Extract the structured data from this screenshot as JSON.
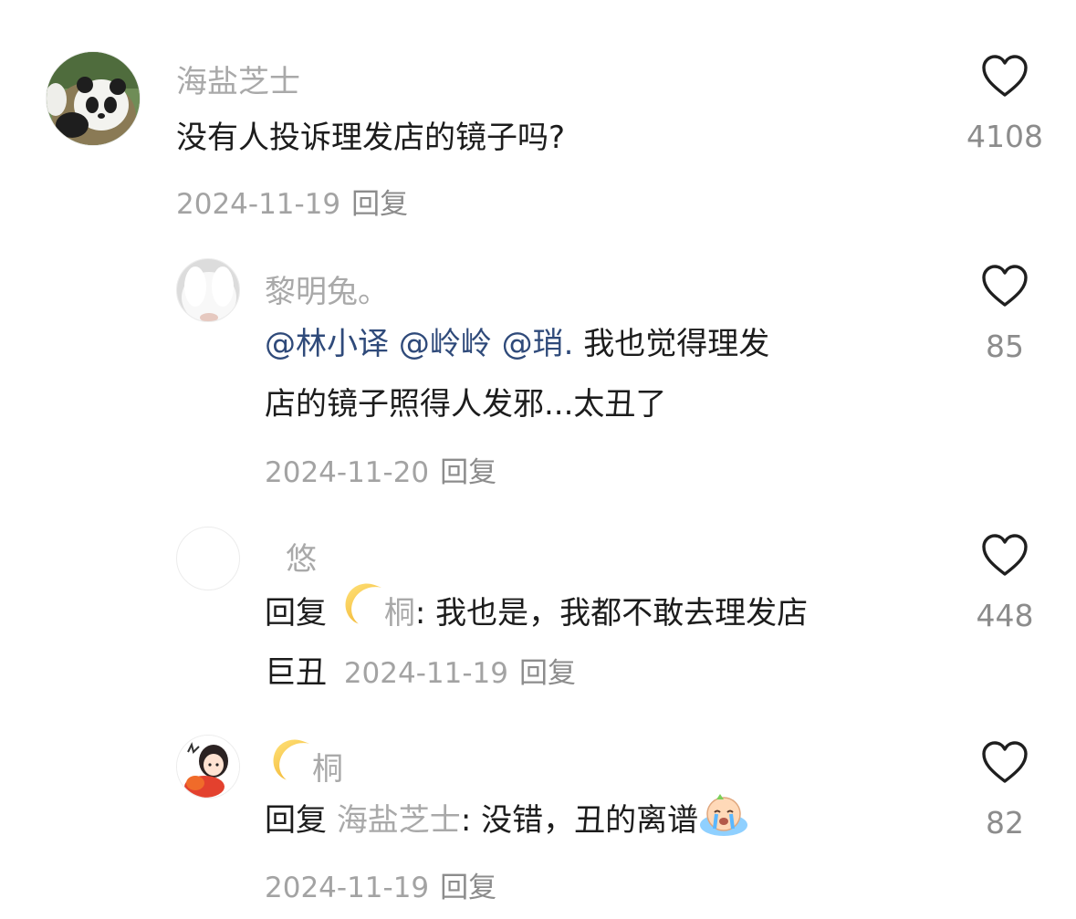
{
  "comments": [
    {
      "username": "海盐芝士",
      "text": "没有人投诉理发店的镜子吗?",
      "date": "2024-11-19",
      "reply_label": "回复",
      "likes": "4108",
      "avatar_icon": "panda-avatar"
    },
    {
      "username": "黎明兔。",
      "mentions": [
        "@林小译",
        "@岭岭",
        "@琑."
      ],
      "text_line1": "我也觉得理发",
      "text_line2": "店的镜子照得人发邪...太丑了",
      "date": "2024-11-20",
      "reply_label": "回复",
      "likes": "85",
      "avatar_icon": "white-rabbit-avatar"
    },
    {
      "username": "悠",
      "reply_prefix": "回复",
      "reply_to": "桐",
      "text_line1": ": 我也是，我都不敢去理发店",
      "text_line2": "巨丑",
      "date": "2024-11-19",
      "reply_label": "回复",
      "likes": "448",
      "avatar_icon": "blank-avatar"
    },
    {
      "username": "桐",
      "reply_prefix": "回复",
      "reply_to": "海盐芝士",
      "text": ": 没错，丑的离谱",
      "date": "2024-11-19",
      "reply_label": "回复",
      "likes": "82",
      "avatar_icon": "girl-cartoon-avatar"
    }
  ],
  "icons": {
    "like": "heart-outline-icon",
    "moon": "crescent-moon-icon",
    "cry": "crying-face-icon"
  },
  "colors": {
    "username": "#a9a9a9",
    "mention": "#2f4a7a",
    "meta": "#a3a3a3"
  }
}
